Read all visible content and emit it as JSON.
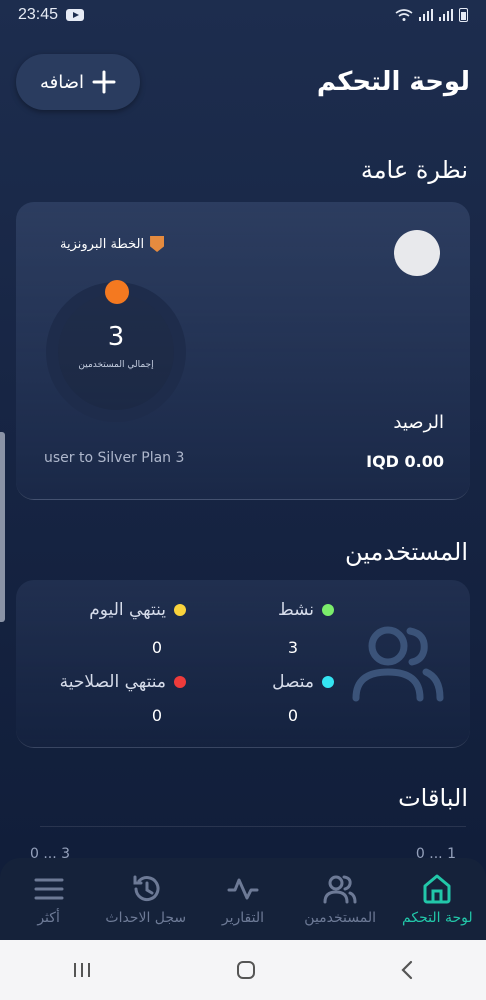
{
  "status": {
    "time": "23:45"
  },
  "header": {
    "title": "لوحة التحكم",
    "add_label": "اضافه"
  },
  "overview": {
    "section_title": "نظرة عامة",
    "plan_name": "الخطة البرونزية",
    "total_users_value": "3",
    "total_users_label": "إجمالي المستخدمين",
    "balance_label": "الرصيد",
    "balance_value": "IQD 0.00",
    "plan_note": "user to Silver Plan 3"
  },
  "users": {
    "section_title": "المستخدمين",
    "stats": [
      {
        "label": "نشط",
        "value": "3",
        "color": "#7bed6b"
      },
      {
        "label": "متصل",
        "value": "0",
        "color": "#34e4f2"
      },
      {
        "label": "ينتهي اليوم",
        "value": "0",
        "color": "#f9d33c"
      },
      {
        "label": "منتهي الصلاحية",
        "value": "0",
        "color": "#ee3b3b"
      }
    ]
  },
  "plans": {
    "section_title": "الباقات",
    "peek_left": "0 ... 3",
    "peek_right": "0 ... 1"
  },
  "nav": [
    {
      "label": "لوحة التحكم",
      "icon": "home-icon",
      "active": true
    },
    {
      "label": "المستخدمين",
      "icon": "users-icon",
      "active": false
    },
    {
      "label": "التقارير",
      "icon": "activity-icon",
      "active": false
    },
    {
      "label": "سجل الاحداث",
      "icon": "history-icon",
      "active": false
    },
    {
      "label": "أكثر",
      "icon": "menu-icon",
      "active": false
    }
  ],
  "colors": {
    "accent": "#22c7a9",
    "plan_badge": "#e58b3f",
    "donut_dot": "#f47920"
  }
}
